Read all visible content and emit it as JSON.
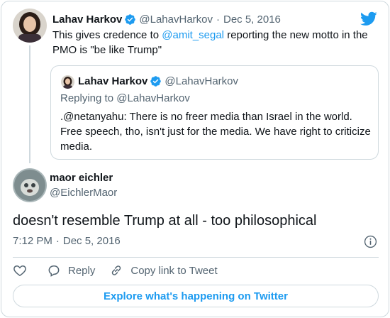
{
  "parent": {
    "name": "Lahav Harkov",
    "handle": "@LahavHarkov",
    "dot": "·",
    "date": "Dec 5, 2016",
    "text_before": "This gives credence to ",
    "mention": "@amit_segal",
    "text_after": " reporting the new motto in the PMO is \"be like Trump\""
  },
  "quoted": {
    "name": "Lahav Harkov",
    "handle": "@LahavHarkov",
    "replying_to": "Replying to @LahavHarkov",
    "text": ".@netanyahu: There is no freer media than Israel in the world. Free speech, tho, isn't just for the media. We have right to criticize media."
  },
  "main": {
    "name": "maor eichler",
    "handle": "@EichlerMaor",
    "text": "doesn't resemble Trump at all - too philosophical",
    "time": "7:12 PM",
    "dot": "·",
    "date": "Dec 5, 2016"
  },
  "actions": {
    "reply_label": "Reply",
    "copy_label": "Copy link to Tweet"
  },
  "explore_label": "Explore what's happening on Twitter",
  "icons": {
    "brand": "twitter-bird-icon",
    "verified": "verified-badge-icon",
    "like": "heart-icon",
    "reply": "speech-bubble-icon",
    "copy": "link-icon",
    "info": "info-icon"
  },
  "colors": {
    "accent": "#1d9bf0",
    "text": "#0f1419",
    "secondary": "#536471",
    "border": "#cfd9de"
  }
}
